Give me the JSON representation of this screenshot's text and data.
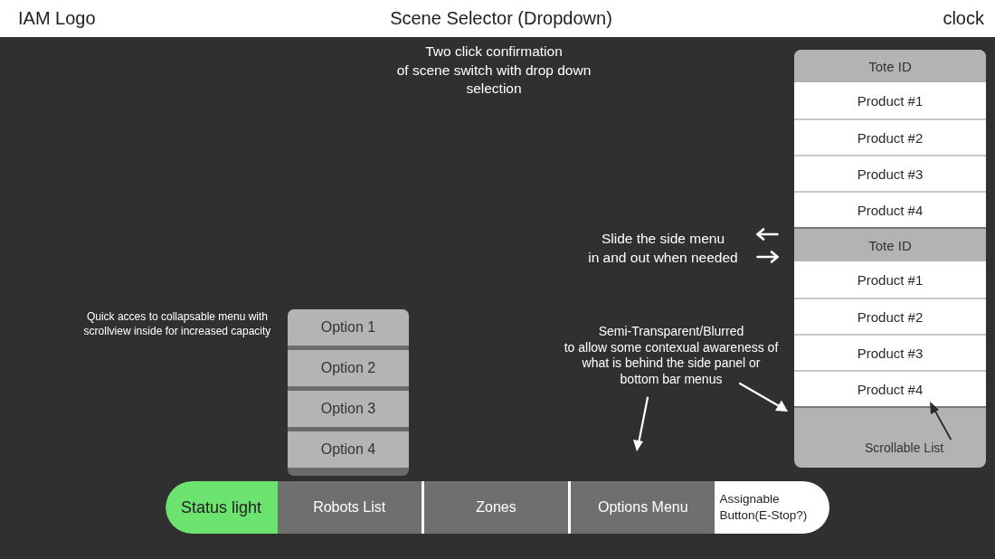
{
  "header": {
    "logo": "IAM Logo",
    "scene_selector": "Scene Selector (Dropdown)",
    "clock": "clock"
  },
  "notes": [
    {
      "text": "Two click confirmation\nof scene switch with drop down\nselection"
    },
    {
      "text": "Slide the side menu\nin and out when needed"
    },
    {
      "text": "Quick acces to collapsable menu with\nscrollview inside for increased capacity"
    },
    {
      "text": "Semi-Transparent/Blurred\nto allow some contexual awareness of\nwhat is behind the side panel or\nbottom bar menus"
    }
  ],
  "options_menu": {
    "items": [
      "Option 1",
      "Option 2",
      "Option 3",
      "Option 4"
    ]
  },
  "side_panel": {
    "groups": [
      {
        "header": "Tote ID",
        "items": [
          "Product #1",
          "Product #2",
          "Product #3",
          "Product #4"
        ]
      },
      {
        "header": "Tote ID",
        "items": [
          "Product #1",
          "Product #2",
          "Product #3",
          "Product #4"
        ]
      }
    ],
    "footer_note": "Scrollable List"
  },
  "bottom_bar": {
    "items": [
      {
        "label": "Status light",
        "kind": "status",
        "color": "#6be36e"
      },
      {
        "label": "Robots List",
        "kind": "menu"
      },
      {
        "label": "Zones",
        "kind": "menu"
      },
      {
        "label": "Options Menu",
        "kind": "menu"
      },
      {
        "label": "Assignable\nButton(E-Stop?)",
        "kind": "assignable"
      }
    ]
  }
}
